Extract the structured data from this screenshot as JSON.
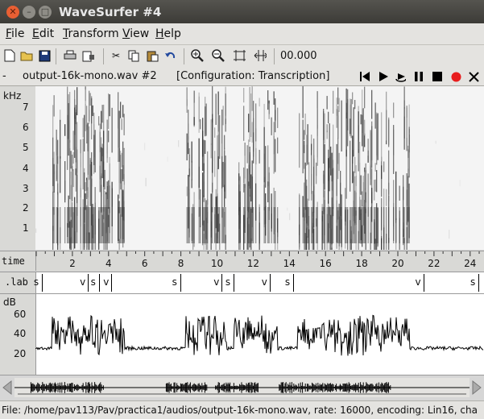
{
  "window": {
    "title": "WaveSurfer #4",
    "close_icon": "close-icon",
    "minimize_icon": "minimize-icon",
    "maximize_icon": "maximize-icon"
  },
  "menu": [
    {
      "label": "File",
      "u": "F"
    },
    {
      "label": "Edit",
      "u": "E"
    },
    {
      "label": "Transform",
      "u": "T"
    },
    {
      "label": "View",
      "u": "V"
    },
    {
      "label": "Help",
      "u": "H"
    }
  ],
  "toolbar": {
    "icons": [
      "new-file-icon",
      "open-folder-icon",
      "save-icon",
      "print-icon",
      "print-setup-icon",
      "cut-icon",
      "copy-icon",
      "paste-icon",
      "undo-icon",
      "zoom-in-icon",
      "zoom-out-icon",
      "zoom-fit-icon",
      "zoom-selection-icon"
    ],
    "time_value": "00.000"
  },
  "filebar": {
    "dash": "-",
    "filename": "output-16k-mono.wav #2",
    "configuration": "[Configuration: Transcription]"
  },
  "spectrogram": {
    "unit_label": "kHz",
    "ticks": [
      "7",
      "6",
      "5",
      "4",
      "3",
      "2",
      "1"
    ]
  },
  "time_axis": {
    "label": "time",
    "ticks": [
      "2",
      "4",
      "6",
      "8",
      "10",
      "12",
      "14",
      "16",
      "18",
      "20",
      "22",
      "24"
    ]
  },
  "transcription": {
    "label": ".lab",
    "marks": [
      "s",
      "v",
      "s",
      "v",
      "s",
      "v",
      "s",
      "v",
      "s",
      "v",
      "s"
    ]
  },
  "power": {
    "unit_label": "dB",
    "ticks": [
      "60",
      "40",
      "20"
    ]
  },
  "status": {
    "text": "File: /home/pav113/Pav/practica1/audios/output-16k-mono.wav, rate: 16000, encoding: Lin16, cha"
  },
  "colors": {
    "record": "#e81d1d",
    "titlebar": "#3c3b37",
    "close": "#e85f33"
  }
}
